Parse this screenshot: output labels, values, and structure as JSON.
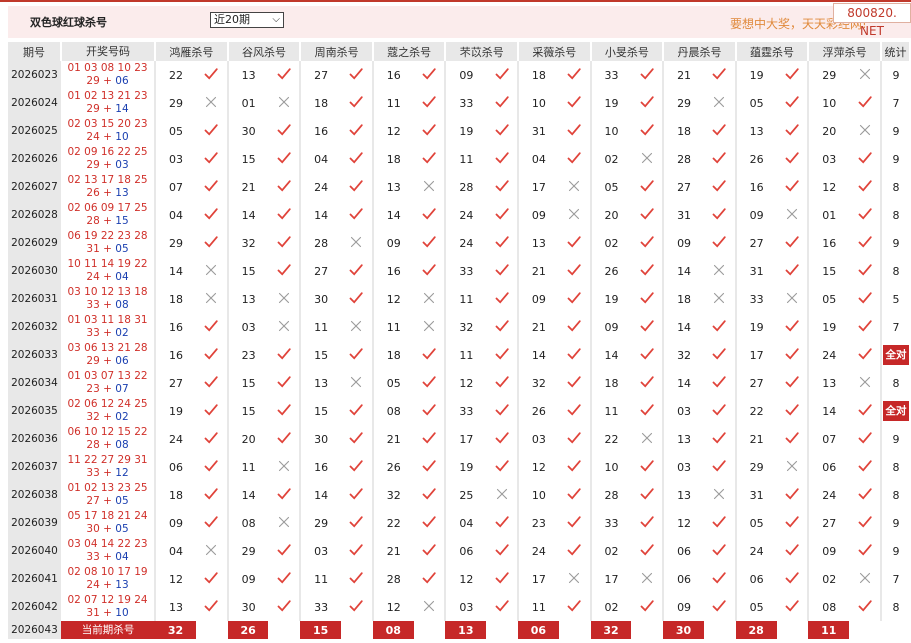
{
  "header": {
    "title": "双色球红球杀号",
    "period_select": "近20期",
    "slogan": "要想中大奖，天天彩经网!",
    "watermark": "800820. NET"
  },
  "columns": {
    "issue": "期号",
    "draw": "开奖号码",
    "experts": [
      "鸿雁杀号",
      "谷风杀号",
      "周南杀号",
      "蔻之杀号",
      "芣苡杀号",
      "采薇杀号",
      "小旻杀号",
      "丹晨杀号",
      "蕴霆杀号",
      "浮萍杀号"
    ],
    "stat": "统计"
  },
  "colors": {
    "accent": "#c62828",
    "check": "#e0433a",
    "cross": "#9a9a9a",
    "red_ball": "#d0302a",
    "blue_ball": "#1a3fb0"
  },
  "rows": [
    {
      "issue": "2026023",
      "red": "01 03 08 10 23",
      "line2": "29 + 06",
      "blue": "06",
      "picks": [
        [
          "22",
          1
        ],
        [
          "13",
          1
        ],
        [
          "27",
          1
        ],
        [
          "16",
          1
        ],
        [
          "09",
          1
        ],
        [
          "18",
          1
        ],
        [
          "33",
          1
        ],
        [
          "21",
          1
        ],
        [
          "19",
          1
        ],
        [
          "29",
          0
        ]
      ],
      "stat": "9"
    },
    {
      "issue": "2026024",
      "red": "01 02 13 21 23",
      "line2": "29 + 14",
      "blue": "14",
      "picks": [
        [
          "29",
          0
        ],
        [
          "01",
          0
        ],
        [
          "18",
          1
        ],
        [
          "11",
          1
        ],
        [
          "33",
          1
        ],
        [
          "10",
          1
        ],
        [
          "19",
          1
        ],
        [
          "29",
          0
        ],
        [
          "05",
          1
        ],
        [
          "10",
          1
        ]
      ],
      "stat": "7"
    },
    {
      "issue": "2026025",
      "red": "02 03 15 20 23",
      "line2": "24 + 10",
      "blue": "10",
      "picks": [
        [
          "05",
          1
        ],
        [
          "30",
          1
        ],
        [
          "16",
          1
        ],
        [
          "12",
          1
        ],
        [
          "19",
          1
        ],
        [
          "31",
          1
        ],
        [
          "10",
          1
        ],
        [
          "18",
          1
        ],
        [
          "13",
          1
        ],
        [
          "20",
          0
        ]
      ],
      "stat": "9"
    },
    {
      "issue": "2026026",
      "red": "02 09 16 22 25",
      "line2": "29 + 03",
      "blue": "03",
      "picks": [
        [
          "03",
          1
        ],
        [
          "15",
          1
        ],
        [
          "04",
          1
        ],
        [
          "18",
          1
        ],
        [
          "11",
          1
        ],
        [
          "04",
          1
        ],
        [
          "02",
          0
        ],
        [
          "28",
          1
        ],
        [
          "26",
          1
        ],
        [
          "03",
          1
        ]
      ],
      "stat": "9"
    },
    {
      "issue": "2026027",
      "red": "02 13 17 18 25",
      "line2": "26 + 13",
      "blue": "13",
      "picks": [
        [
          "07",
          1
        ],
        [
          "21",
          1
        ],
        [
          "24",
          1
        ],
        [
          "13",
          0
        ],
        [
          "28",
          1
        ],
        [
          "17",
          0
        ],
        [
          "05",
          1
        ],
        [
          "27",
          1
        ],
        [
          "16",
          1
        ],
        [
          "12",
          1
        ]
      ],
      "stat": "8"
    },
    {
      "issue": "2026028",
      "red": "02 06 09 17 25",
      "line2": "28 + 15",
      "blue": "15",
      "picks": [
        [
          "04",
          1
        ],
        [
          "14",
          1
        ],
        [
          "14",
          1
        ],
        [
          "14",
          1
        ],
        [
          "24",
          1
        ],
        [
          "09",
          0
        ],
        [
          "20",
          1
        ],
        [
          "31",
          1
        ],
        [
          "09",
          0
        ],
        [
          "01",
          1
        ]
      ],
      "stat": "8"
    },
    {
      "issue": "2026029",
      "red": "06 19 22 23 28",
      "line2": "31 + 05",
      "blue": "05",
      "picks": [
        [
          "29",
          1
        ],
        [
          "32",
          1
        ],
        [
          "28",
          0
        ],
        [
          "09",
          1
        ],
        [
          "24",
          1
        ],
        [
          "13",
          1
        ],
        [
          "02",
          1
        ],
        [
          "09",
          1
        ],
        [
          "27",
          1
        ],
        [
          "16",
          1
        ]
      ],
      "stat": "9"
    },
    {
      "issue": "2026030",
      "red": "10 11 14 19 22",
      "line2": "24 + 04",
      "blue": "04",
      "picks": [
        [
          "14",
          0
        ],
        [
          "15",
          1
        ],
        [
          "27",
          1
        ],
        [
          "16",
          1
        ],
        [
          "33",
          1
        ],
        [
          "21",
          1
        ],
        [
          "26",
          1
        ],
        [
          "14",
          0
        ],
        [
          "31",
          1
        ],
        [
          "15",
          1
        ]
      ],
      "stat": "8"
    },
    {
      "issue": "2026031",
      "red": "03 10 12 13 18",
      "line2": "33 + 08",
      "blue": "08",
      "picks": [
        [
          "18",
          0
        ],
        [
          "13",
          0
        ],
        [
          "30",
          1
        ],
        [
          "12",
          0
        ],
        [
          "11",
          1
        ],
        [
          "09",
          1
        ],
        [
          "19",
          1
        ],
        [
          "18",
          0
        ],
        [
          "33",
          0
        ],
        [
          "05",
          1
        ]
      ],
      "stat": "5"
    },
    {
      "issue": "2026032",
      "red": "01 03 11 18 31",
      "line2": "33 + 02",
      "blue": "02",
      "picks": [
        [
          "16",
          1
        ],
        [
          "03",
          0
        ],
        [
          "11",
          0
        ],
        [
          "11",
          0
        ],
        [
          "32",
          1
        ],
        [
          "21",
          1
        ],
        [
          "09",
          1
        ],
        [
          "14",
          1
        ],
        [
          "19",
          1
        ],
        [
          "19",
          1
        ]
      ],
      "stat": "7"
    },
    {
      "issue": "2026033",
      "red": "03 06 13 21 28",
      "line2": "29 + 06",
      "blue": "06",
      "picks": [
        [
          "16",
          1
        ],
        [
          "23",
          1
        ],
        [
          "15",
          1
        ],
        [
          "18",
          1
        ],
        [
          "11",
          1
        ],
        [
          "14",
          1
        ],
        [
          "14",
          1
        ],
        [
          "32",
          1
        ],
        [
          "17",
          1
        ],
        [
          "24",
          1
        ]
      ],
      "stat": "全对"
    },
    {
      "issue": "2026034",
      "red": "01 03 07 13 22",
      "line2": "23 + 07",
      "blue": "07",
      "picks": [
        [
          "27",
          1
        ],
        [
          "15",
          1
        ],
        [
          "13",
          0
        ],
        [
          "05",
          1
        ],
        [
          "12",
          1
        ],
        [
          "32",
          1
        ],
        [
          "18",
          1
        ],
        [
          "14",
          1
        ],
        [
          "27",
          1
        ],
        [
          "13",
          0
        ]
      ],
      "stat": "8"
    },
    {
      "issue": "2026035",
      "red": "02 06 12 24 25",
      "line2": "32 + 02",
      "blue": "02",
      "picks": [
        [
          "19",
          1
        ],
        [
          "15",
          1
        ],
        [
          "15",
          1
        ],
        [
          "08",
          1
        ],
        [
          "33",
          1
        ],
        [
          "26",
          1
        ],
        [
          "11",
          1
        ],
        [
          "03",
          1
        ],
        [
          "22",
          1
        ],
        [
          "14",
          1
        ]
      ],
      "stat": "全对"
    },
    {
      "issue": "2026036",
      "red": "06 10 12 15 22",
      "line2": "28 + 08",
      "blue": "08",
      "picks": [
        [
          "24",
          1
        ],
        [
          "20",
          1
        ],
        [
          "30",
          1
        ],
        [
          "21",
          1
        ],
        [
          "17",
          1
        ],
        [
          "03",
          1
        ],
        [
          "22",
          0
        ],
        [
          "13",
          1
        ],
        [
          "21",
          1
        ],
        [
          "07",
          1
        ]
      ],
      "stat": "9"
    },
    {
      "issue": "2026037",
      "red": "11 22 27 29 31",
      "line2": "33 + 12",
      "blue": "12",
      "picks": [
        [
          "06",
          1
        ],
        [
          "11",
          0
        ],
        [
          "16",
          1
        ],
        [
          "26",
          1
        ],
        [
          "19",
          1
        ],
        [
          "12",
          1
        ],
        [
          "10",
          1
        ],
        [
          "03",
          1
        ],
        [
          "29",
          0
        ],
        [
          "06",
          1
        ]
      ],
      "stat": "8"
    },
    {
      "issue": "2026038",
      "red": "01 02 13 23 25",
      "line2": "27 + 05",
      "blue": "05",
      "picks": [
        [
          "18",
          1
        ],
        [
          "14",
          1
        ],
        [
          "14",
          1
        ],
        [
          "32",
          1
        ],
        [
          "25",
          0
        ],
        [
          "10",
          1
        ],
        [
          "28",
          1
        ],
        [
          "13",
          0
        ],
        [
          "31",
          1
        ],
        [
          "24",
          1
        ]
      ],
      "stat": "8"
    },
    {
      "issue": "2026039",
      "red": "05 17 18 21 24",
      "line2": "30 + 05",
      "blue": "05",
      "picks": [
        [
          "09",
          1
        ],
        [
          "08",
          0
        ],
        [
          "29",
          1
        ],
        [
          "22",
          1
        ],
        [
          "04",
          1
        ],
        [
          "23",
          1
        ],
        [
          "33",
          1
        ],
        [
          "12",
          1
        ],
        [
          "05",
          1
        ],
        [
          "27",
          1
        ]
      ],
      "stat": "9"
    },
    {
      "issue": "2026040",
      "red": "03 04 14 22 23",
      "line2": "33 + 04",
      "blue": "04",
      "picks": [
        [
          "04",
          0
        ],
        [
          "29",
          1
        ],
        [
          "03",
          1
        ],
        [
          "21",
          1
        ],
        [
          "06",
          1
        ],
        [
          "24",
          1
        ],
        [
          "02",
          1
        ],
        [
          "06",
          1
        ],
        [
          "24",
          1
        ],
        [
          "09",
          1
        ]
      ],
      "stat": "9"
    },
    {
      "issue": "2026041",
      "red": "02 08 10 17 19",
      "line2": "24 + 13",
      "blue": "13",
      "picks": [
        [
          "12",
          1
        ],
        [
          "09",
          1
        ],
        [
          "11",
          1
        ],
        [
          "28",
          1
        ],
        [
          "12",
          1
        ],
        [
          "17",
          0
        ],
        [
          "17",
          0
        ],
        [
          "06",
          1
        ],
        [
          "06",
          1
        ],
        [
          "02",
          0
        ]
      ],
      "stat": "7"
    },
    {
      "issue": "2026042",
      "red": "02 07 12 19 24",
      "line2": "31 + 10",
      "blue": "10",
      "picks": [
        [
          "13",
          1
        ],
        [
          "30",
          1
        ],
        [
          "33",
          1
        ],
        [
          "12",
          0
        ],
        [
          "03",
          1
        ],
        [
          "11",
          1
        ],
        [
          "02",
          1
        ],
        [
          "09",
          1
        ],
        [
          "05",
          1
        ],
        [
          "08",
          1
        ]
      ],
      "stat": "8"
    }
  ],
  "footer": {
    "issue": "2026043",
    "label": "当前期杀号",
    "values": [
      "32",
      "26",
      "15",
      "08",
      "13",
      "06",
      "32",
      "30",
      "28",
      "11"
    ]
  }
}
